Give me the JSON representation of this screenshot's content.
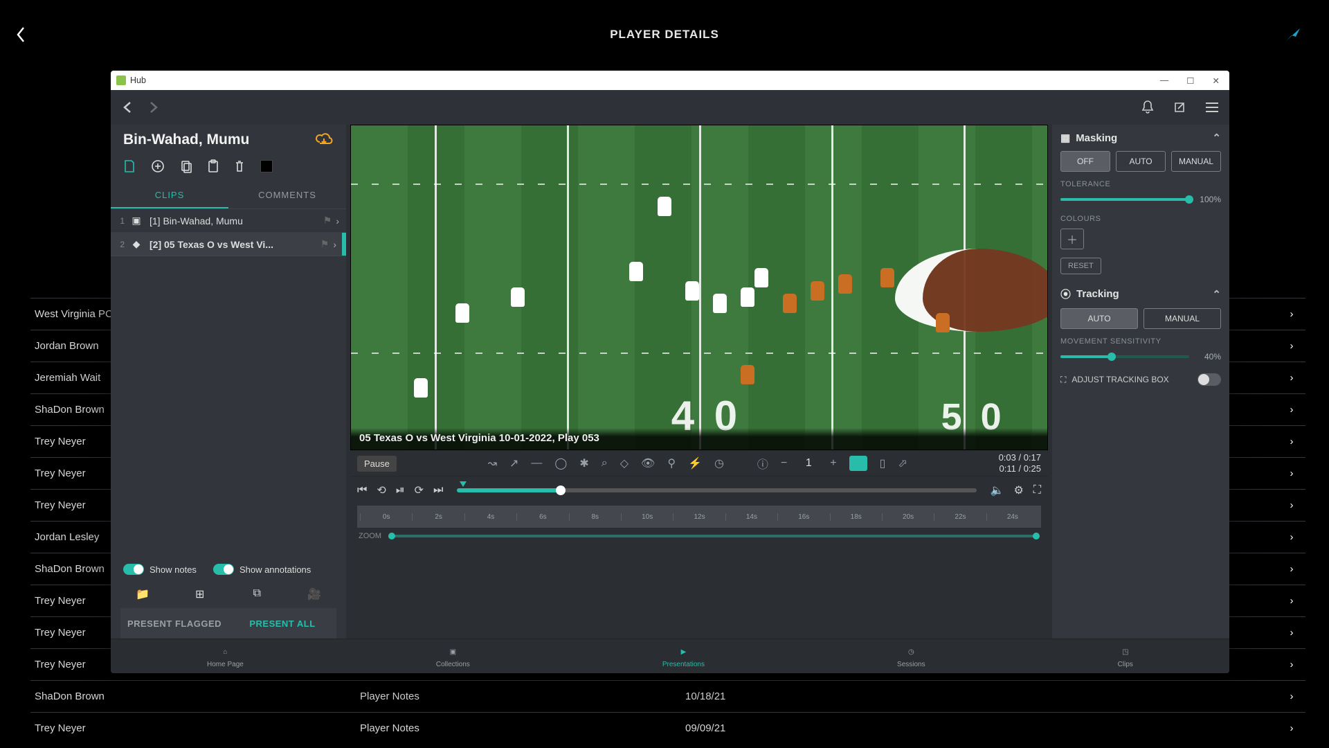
{
  "header": {
    "title": "PLAYER DETAILS"
  },
  "window": {
    "app_name": "Hub"
  },
  "player": {
    "full_name": "Bin-Wahad, Mumu"
  },
  "tabs": {
    "clips": "CLIPS",
    "comments": "COMMENTS"
  },
  "clips": [
    {
      "idx": "1",
      "title": "[1] Bin-Wahad, Mumu",
      "selected": false
    },
    {
      "idx": "2",
      "title": "[2] 05 Texas O vs West Vi...",
      "selected": true
    }
  ],
  "sidebar_toggles": {
    "show_notes": "Show notes",
    "show_annotations": "Show annotations"
  },
  "present": {
    "flagged": "PRESENT FLAGGED",
    "all": "PRESENT ALL"
  },
  "video": {
    "caption": "05 Texas O vs West Virginia 10-01-2022, Play 053",
    "pause_label": "Pause",
    "tool_number": "1",
    "time_a": "0:03 / 0:17",
    "time_b": "0:11 / 0:25"
  },
  "zoom_label": "ZOOM",
  "right_panel": {
    "masking": {
      "title": "Masking",
      "off": "OFF",
      "auto": "AUTO",
      "manual": "MANUAL",
      "tolerance_label": "TOLERANCE",
      "tolerance_pct": "100%",
      "colours_label": "COLOURS",
      "reset": "RESET"
    },
    "tracking": {
      "title": "Tracking",
      "auto": "AUTO",
      "manual": "MANUAL",
      "sensitivity_label": "MOVEMENT SENSITIVITY",
      "sensitivity_pct": "40%",
      "adjust_box": "ADJUST TRACKING BOX"
    }
  },
  "bottom_nav": {
    "home": "Home Page",
    "collections": "Collections",
    "presentations": "Presentations",
    "sessions": "Sessions",
    "clips": "Clips"
  },
  "bg_rows": [
    {
      "name": "West Virginia PC",
      "notes": "",
      "date": ""
    },
    {
      "name": "Jordan Brown",
      "notes": "",
      "date": ""
    },
    {
      "name": "Jeremiah Wait",
      "notes": "",
      "date": ""
    },
    {
      "name": "ShaDon Brown",
      "notes": "",
      "date": ""
    },
    {
      "name": "Trey Neyer",
      "notes": "",
      "date": ""
    },
    {
      "name": "Trey Neyer",
      "notes": "",
      "date": ""
    },
    {
      "name": "Trey Neyer",
      "notes": "",
      "date": ""
    },
    {
      "name": "Jordan Lesley",
      "notes": "",
      "date": ""
    },
    {
      "name": "ShaDon Brown",
      "notes": "",
      "date": ""
    },
    {
      "name": "Trey Neyer",
      "notes": "",
      "date": ""
    },
    {
      "name": "Trey Neyer",
      "notes": "",
      "date": ""
    },
    {
      "name": "Trey Neyer",
      "notes": "",
      "date": ""
    },
    {
      "name": "ShaDon Brown",
      "notes": "Player Notes",
      "date": "10/18/21"
    },
    {
      "name": "Trey Neyer",
      "notes": "Player Notes",
      "date": "09/09/21"
    }
  ],
  "timeline_marks": [
    "0s",
    "2s",
    "4s",
    "6s",
    "8s",
    "10s",
    "12s",
    "14s",
    "16s",
    "18s",
    "20s",
    "22s",
    "24s"
  ]
}
